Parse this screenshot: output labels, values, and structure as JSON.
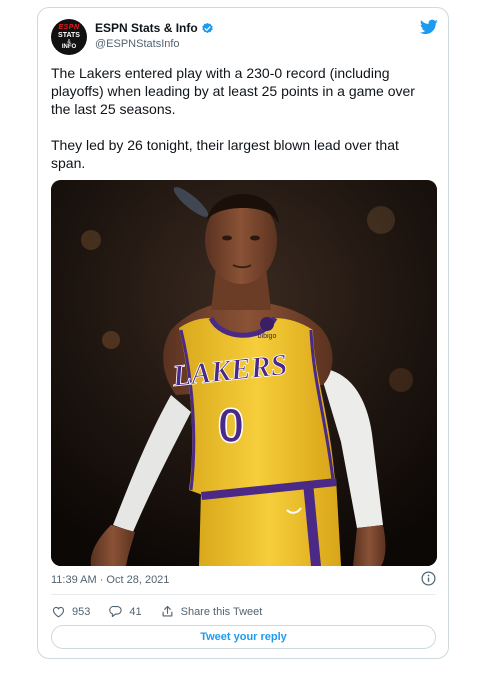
{
  "tweet": {
    "display_name": "ESPN Stats & Info",
    "handle": "@ESPNStatsInfo",
    "avatar_text": [
      "ESPN",
      "STATS",
      "&",
      "INFO"
    ],
    "paragraph1": "The Lakers entered play with a 230-0 record (including playoffs) when leading by at least 25 points in a game over the last 25 seasons.",
    "paragraph2": "They led by 26 tonight, their largest blown lead over that span.",
    "timestamp": "11:39 AM · Oct 28, 2021",
    "photo": {
      "jersey_wordmark": "LAKERS",
      "jersey_number": "0",
      "jersey_patch": "bibigo"
    }
  },
  "actions": {
    "like_count": "953",
    "reply_count": "41",
    "share_label": "Share this Tweet"
  },
  "reply_button": "Tweet your reply",
  "colors": {
    "accent": "#1d9bf0",
    "jersey_gold": "#f2c530",
    "jersey_purple": "#4a2a86"
  }
}
